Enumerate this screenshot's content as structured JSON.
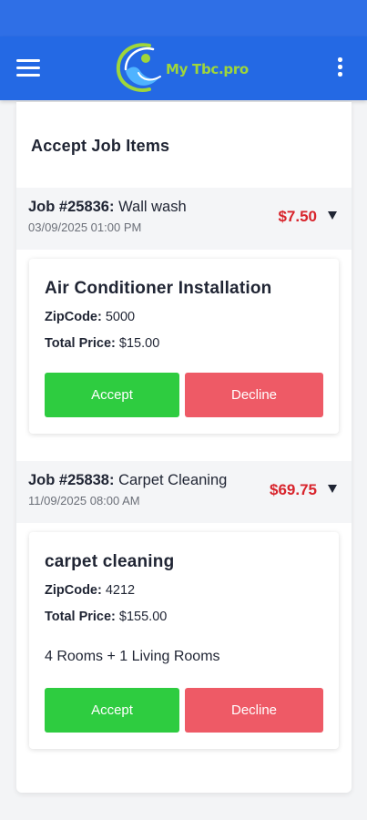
{
  "app": {
    "title": "My Tbc.pro",
    "brand_colors": {
      "primary": "#2469e4",
      "accept": "#2ecc40",
      "decline": "#ee5a66",
      "price": "#d8242c"
    }
  },
  "header": {
    "menu_icon": "hamburger-menu-icon",
    "more_icon": "more-vertical-icon",
    "logo_text": "My Tbc.pro"
  },
  "page": {
    "title": "Accept Job Items"
  },
  "jobs": [
    {
      "job_number": "Job #25836:",
      "job_name": "Wall wash",
      "date": "03/09/2025 01:00 PM",
      "price": "$7.50",
      "expand_icon": "caret-down-icon",
      "items": [
        {
          "title": "Air Conditioner Installation",
          "zip_label": "ZipCode:",
          "zip_value": "5000",
          "total_label": "Total Price:",
          "total_value": "$15.00",
          "extra": "",
          "accept_label": "Accept",
          "decline_label": "Decline"
        }
      ]
    },
    {
      "job_number": "Job #25838:",
      "job_name": "Carpet Cleaning",
      "date": "11/09/2025 08:00 AM",
      "price": "$69.75",
      "expand_icon": "caret-down-icon",
      "items": [
        {
          "title": "carpet cleaning",
          "zip_label": "ZipCode:",
          "zip_value": "4212",
          "total_label": "Total Price:",
          "total_value": "$155.00",
          "extra": "4 Rooms + 1 Living Rooms",
          "accept_label": "Accept",
          "decline_label": "Decline"
        }
      ]
    }
  ]
}
